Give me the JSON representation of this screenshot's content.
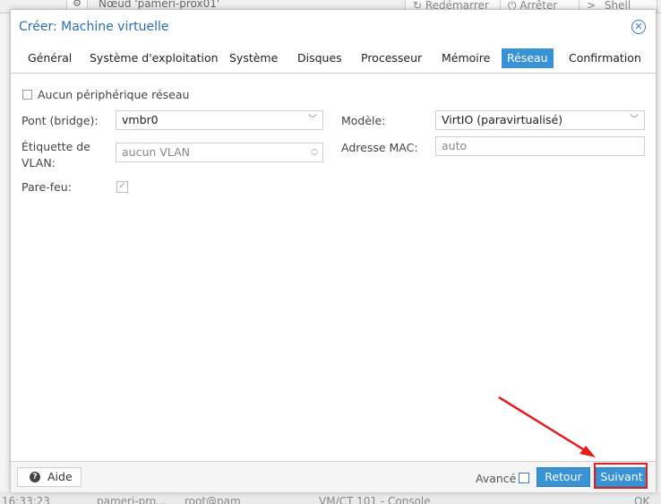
{
  "background": {
    "node_label": "Nœud 'pameri-prox01'",
    "restart_label": "Redémarrer",
    "stop_label": "Arrêter",
    "shell_label": "Shell",
    "bottom_time": "16:33:23",
    "bottom_node": "pameri-pro...",
    "bottom_user": "root@pam",
    "bottom_desc": "VM/CT 101 - Console",
    "bottom_status": "OK"
  },
  "dialog": {
    "title": "Créer: Machine virtuelle",
    "tabs": [
      {
        "label": "Général"
      },
      {
        "label": "Système d'exploitation"
      },
      {
        "label": "Système"
      },
      {
        "label": "Disques"
      },
      {
        "label": "Processeur"
      },
      {
        "label": "Mémoire"
      },
      {
        "label": "Réseau",
        "active": true
      },
      {
        "label": "Confirmation"
      }
    ],
    "form": {
      "no_network_label": "Aucun périphérique réseau",
      "bridge_label": "Pont (bridge):",
      "bridge_value": "vmbr0",
      "vlan_label_line1": "Étiquette de",
      "vlan_label_line2": "VLAN:",
      "vlan_value": "aucun VLAN",
      "firewall_label": "Pare-feu:",
      "model_label": "Modèle:",
      "model_value": "VirtIO (paravirtualisé)",
      "mac_label": "Adresse MAC:",
      "mac_value": "auto"
    },
    "footer": {
      "help_label": "Aide",
      "advanced_label": "Avancé",
      "back_label": "Retour",
      "next_label": "Suivant"
    }
  },
  "colors": {
    "accent": "#3892d4",
    "highlight": "#e02020"
  }
}
